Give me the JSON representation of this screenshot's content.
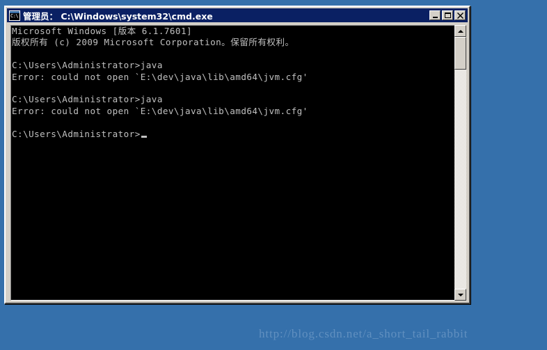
{
  "desktop": {
    "background_color": "#3570ab"
  },
  "window": {
    "title": "管理员： C:\\Windows\\system32\\cmd.exe",
    "icon_name": "cmd-icon",
    "icon_label": "C:\\",
    "title_bar_color": "#0a2063",
    "frame_color": "#d4d0c8",
    "controls": {
      "minimize_label": "_",
      "maximize_label": "□",
      "close_label": "✕"
    }
  },
  "console": {
    "background_color": "#000000",
    "text_color": "#c0c0c0",
    "lines": [
      "Microsoft Windows [版本 6.1.7601]",
      "版权所有 (c) 2009 Microsoft Corporation。保留所有权利。",
      "",
      "C:\\Users\\Administrator>java",
      "Error: could not open `E:\\dev\\java\\lib\\amd64\\jvm.cfg'",
      "",
      "C:\\Users\\Administrator>java",
      "Error: could not open `E:\\dev\\java\\lib\\amd64\\jvm.cfg'",
      "",
      "C:\\Users\\Administrator>"
    ],
    "prompt_last": "C:\\Users\\Administrator>",
    "cursor_visible": true
  },
  "scrollbar": {
    "up_arrow_name": "scroll-up-arrow",
    "down_arrow_name": "scroll-down-arrow",
    "thumb_name": "scroll-thumb"
  },
  "watermark": {
    "text": "http://blog.csdn.net/a_short_tail_rabbit",
    "color": "#6190c0"
  }
}
